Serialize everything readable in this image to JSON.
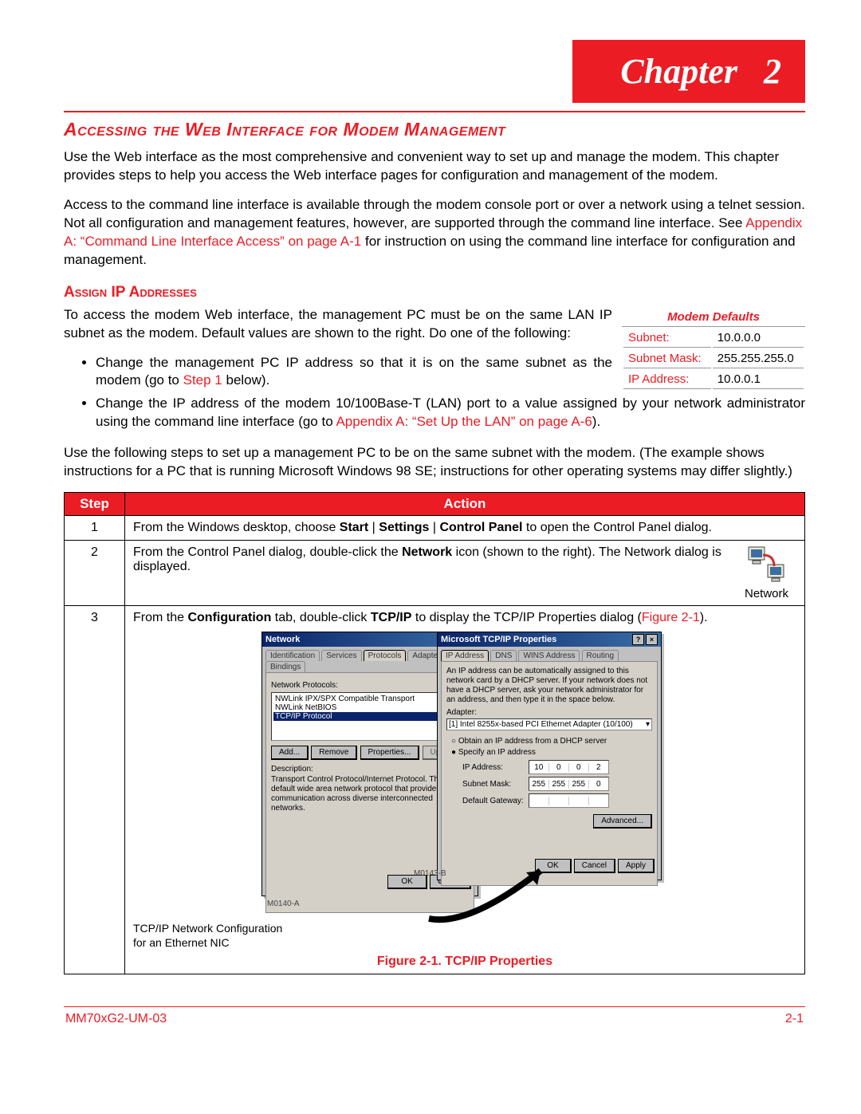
{
  "chapter": {
    "label": "Chapter",
    "number": "2"
  },
  "section_title": "Accessing the Web Interface for Modem Management",
  "intro_p1": "Use the Web interface as the most comprehensive and convenient way to set up and manage the modem. This chapter provides steps to help you access the Web interface pages for configuration and management of the modem.",
  "intro_p2_a": "Access to the command line interface is available through the modem console port or over a network using a telnet session. Not all configuration and management features, however, are supported through the command line interface. See ",
  "intro_p2_link": "Appendix A: “Command Line Interface Access” on page A-1",
  "intro_p2_b": " for instruction on using the command line interface for configuration and management.",
  "assign_title": "Assign IP Addresses",
  "assign_p1": "To access the modem Web interface, the management PC must be on the same LAN IP subnet as the modem. Default values are shown to the right. Do one of the following:",
  "defaults": {
    "caption": "Modem Defaults",
    "rows": [
      {
        "label": "Subnet:",
        "value": "10.0.0.0"
      },
      {
        "label": "Subnet Mask:",
        "value": "255.255.255.0"
      },
      {
        "label": "IP Address:",
        "value": "10.0.0.1"
      }
    ]
  },
  "bullet1_a": "Change the management PC IP address so that it is on the same subnet as the modem (go to ",
  "bullet1_link": "Step 1",
  "bullet1_b": " below).",
  "bullet2_a": "Change the IP address of the modem 10/100Base-T (LAN) port to a value assigned by your network administrator using the command line interface (go to ",
  "bullet2_link": "Appendix A: “Set Up the LAN” on page A-6",
  "bullet2_b": ").",
  "assign_p2": "Use the following steps to set up a management PC to be on the same subnet with the modem. (The example shows instructions for a PC that is running Microsoft Windows 98 SE; instructions for other operating systems may differ slightly.)",
  "table": {
    "head_step": "Step",
    "head_action": "Action",
    "r1_num": "1",
    "r1_a": "From the Windows desktop, choose ",
    "r1_b1": "Start",
    "r1_sep1": " | ",
    "r1_b2": "Settings",
    "r1_sep2": " | ",
    "r1_b3": "Control Panel",
    "r1_c": " to open the Control Panel dialog.",
    "r2_num": "2",
    "r2_a": "From the Control Panel dialog, double-click the ",
    "r2_b": "Network",
    "r2_c": " icon (shown to the right). The Network dialog is displayed.",
    "r2_iconlabel": "Network",
    "r3_num": "3",
    "r3_a": "From the ",
    "r3_b1": "Configuration",
    "r3_mid": " tab, double-click ",
    "r3_b2": "TCP/IP",
    "r3_c": " to display the TCP/IP Properties dialog (",
    "r3_link": "Figure 2-1",
    "r3_end": ")."
  },
  "dialog_left": {
    "title": "Network",
    "tabs": [
      "Identification",
      "Services",
      "Protocols",
      "Adapters",
      "Bindings"
    ],
    "list_label": "Network Protocols:",
    "items": [
      "NWLink IPX/SPX Compatible Transport",
      "NWLink NetBIOS",
      "TCP/IP Protocol"
    ],
    "btn_add": "Add...",
    "btn_remove": "Remove",
    "btn_prop": "Properties...",
    "btn_update": "Update",
    "desc_label": "Description:",
    "desc": "Transport Control Protocol/Internet Protocol. The default wide area network protocol that provides communication across diverse interconnected networks.",
    "ok": "OK",
    "cancel": "Cancel",
    "mark": "M0140-A"
  },
  "dialog_right": {
    "title": "Microsoft TCP/IP Properties",
    "tabs": [
      "IP Address",
      "DNS",
      "WINS Address",
      "Routing"
    ],
    "para": "An IP address can be automatically assigned to this network card by a DHCP server. If your network does not have a DHCP server, ask your network administrator for an address, and then type it in the space below.",
    "adapter_lbl": "Adapter:",
    "adapter_val": "[1] Intel 8255x-based PCI Ethernet Adapter (10/100)",
    "r1": "Obtain an IP address from a DHCP server",
    "r2": "Specify an IP address",
    "ip_lbl": "IP Address:",
    "ip": [
      "10",
      "0",
      "0",
      "2"
    ],
    "mask_lbl": "Subnet Mask:",
    "mask": [
      "255",
      "255",
      "255",
      "0"
    ],
    "gw_lbl": "Default Gateway:",
    "adv": "Advanced...",
    "ok": "OK",
    "cancel": "Cancel",
    "apply": "Apply",
    "mark": "M0143-B"
  },
  "fig_annot_l1": "TCP/IP Network Configuration",
  "fig_annot_l2": "for an Ethernet NIC",
  "fig_caption": "Figure 2-1. TCP/IP Properties",
  "footer": {
    "left": "MM70xG2-UM-03",
    "right": "2-1"
  }
}
